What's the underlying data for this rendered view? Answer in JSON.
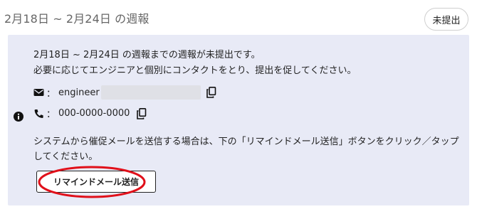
{
  "header": {
    "title": "2月18日 ~ 2月24日 の週報",
    "status_label": "未提出"
  },
  "notice": {
    "line1": "2月18日 ~ 2月24日 の週報までの週報が未提出です。",
    "line2": "必要に応じてエンジニアと個別にコンタクトをとり、提出を促してください。",
    "email_prefix": "engineer",
    "phone": "000-0000-0000",
    "line3": "システムから催促メールを送信する場合は、下の「リマインドメール送信」ボタンをクリック／タップ",
    "line4": "してください。",
    "remind_button": "リマインドメール送信"
  },
  "colors": {
    "panel_bg": "#e8eaf6",
    "annotation": "#e0101a"
  },
  "icons": [
    "info-icon",
    "envelope-icon",
    "phone-icon",
    "copy-icon"
  ]
}
